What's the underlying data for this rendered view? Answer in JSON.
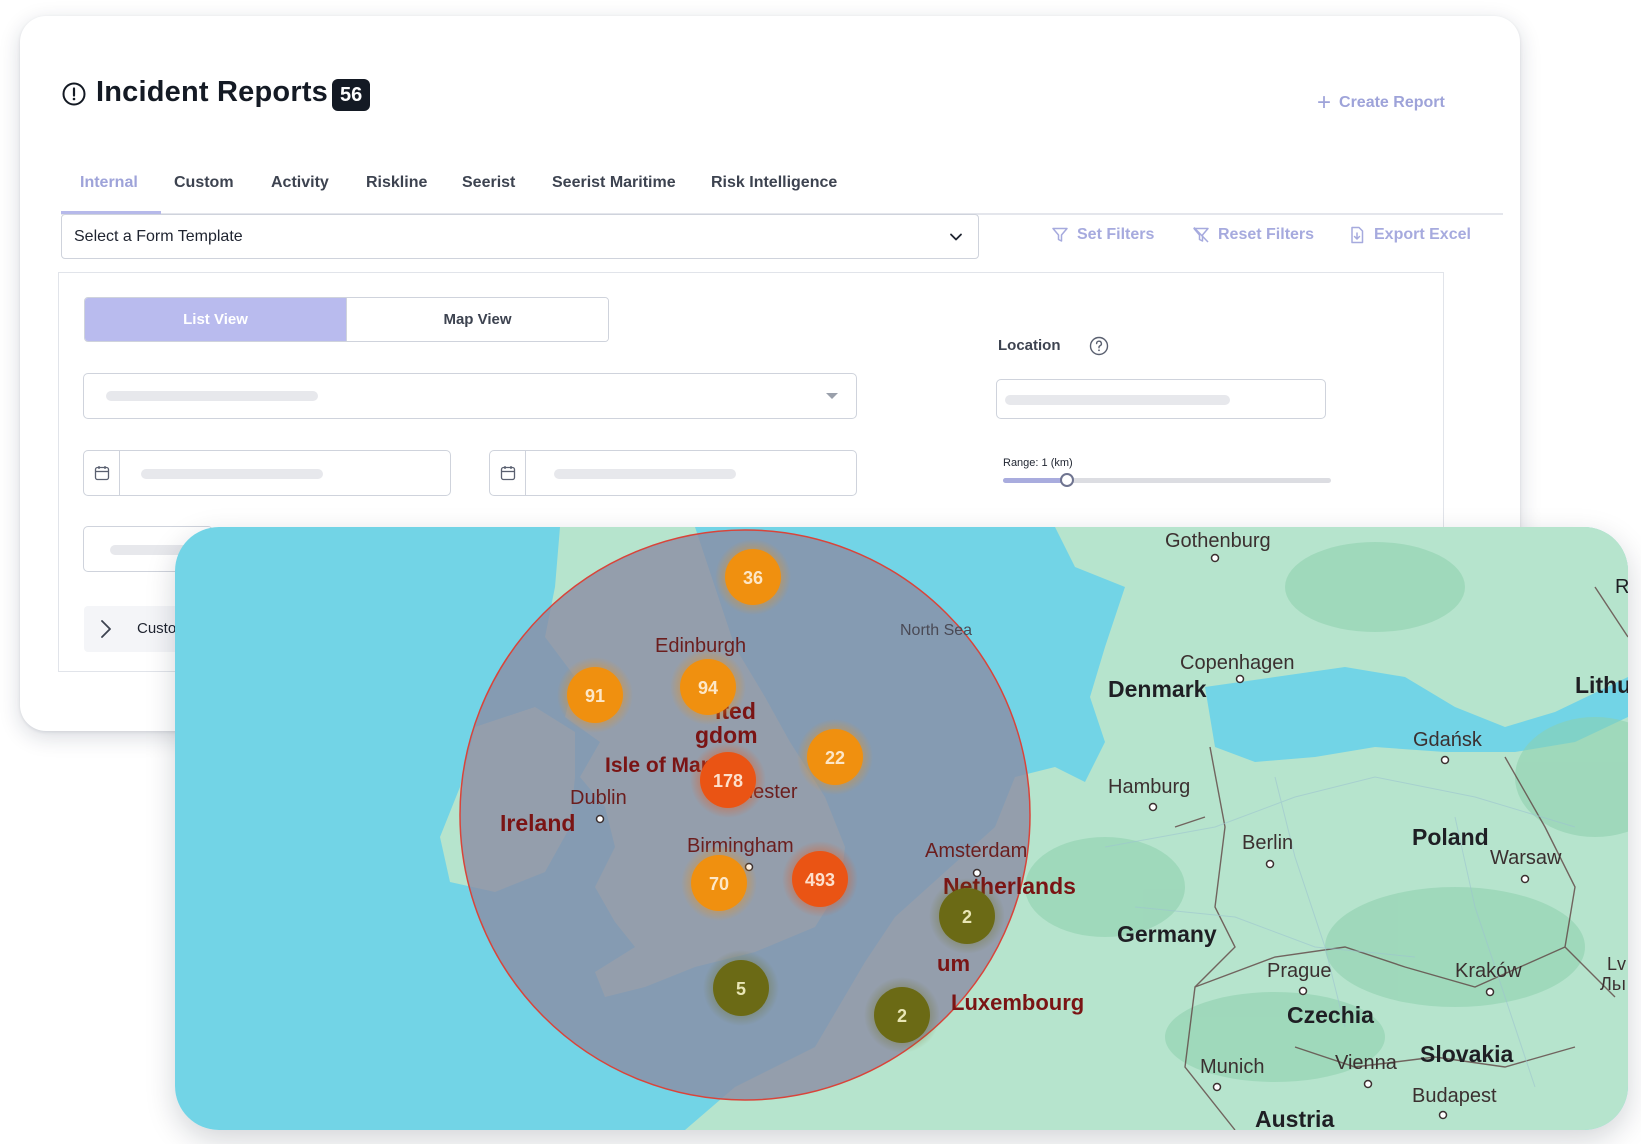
{
  "header": {
    "title": "Incident Reports",
    "count": "56",
    "create_label": "Create Report"
  },
  "tabs": [
    {
      "label": "Internal",
      "active": true
    },
    {
      "label": "Custom"
    },
    {
      "label": "Activity"
    },
    {
      "label": "Riskline"
    },
    {
      "label": "Seerist"
    },
    {
      "label": "Seerist Maritime"
    },
    {
      "label": "Risk Intelligence"
    }
  ],
  "template_select": {
    "value": "Select a Form Template"
  },
  "actions": {
    "set_filters": "Set Filters",
    "reset_filters": "Reset Filters",
    "export_excel": "Export Excel"
  },
  "view_toggle": {
    "list": "List View",
    "map": "Map View",
    "selected": "List View"
  },
  "location": {
    "label": "Location",
    "range_label": "Range: 1 (km)",
    "range_fraction": 0.2
  },
  "custom_row": {
    "label": "Custo"
  },
  "colors": {
    "accent": "#b9bbee",
    "accent_text": "#9ea3d9",
    "sea": "#72d4e6",
    "land": "#b6e4cd",
    "radius_fill": "#8a8aa3",
    "cluster_orange": "#f0900f",
    "cluster_red": "#ea5414",
    "cluster_olive": "#6b6a15"
  },
  "map": {
    "labels": {
      "gothenburg": "Gothenburg",
      "north_sea": "North Sea",
      "edinburgh": "Edinburgh",
      "copenhagen": "Copenhagen",
      "denmark": "Denmark",
      "united_kingdom_1": "ited",
      "united_kingdom_2": "gdom",
      "isle_of_man": "Isle of Man",
      "dublin": "Dublin",
      "ireland": "Ireland",
      "manchester": "hester",
      "birmingham": "Birmingham",
      "london": "n",
      "amsterdam": "Amsterdam",
      "netherlands": "Netherlands",
      "hamburg": "Hamburg",
      "berlin": "Berlin",
      "gdansk": "Gdańsk",
      "poland": "Poland",
      "warsaw": "Warsaw",
      "germany": "Germany",
      "belgium": "um",
      "luxembourg": "Luxembourg",
      "prague": "Prague",
      "czechia": "Czechia",
      "krakow": "Kraków",
      "munich": "Munich",
      "vienna": "Vienna",
      "slovakia": "Slovakia",
      "budapest": "Budapest",
      "austria": "Austria",
      "lithuania": "Lithu",
      "riga": "Ri",
      "lviv_1": "Lv",
      "lviv_2": "Льı"
    },
    "clusters": [
      {
        "id": "c36",
        "count": "36",
        "severity": "orange"
      },
      {
        "id": "c91",
        "count": "91",
        "severity": "orange"
      },
      {
        "id": "c94",
        "count": "94",
        "severity": "orange"
      },
      {
        "id": "c22",
        "count": "22",
        "severity": "orange"
      },
      {
        "id": "c178",
        "count": "178",
        "severity": "red"
      },
      {
        "id": "c70",
        "count": "70",
        "severity": "orange"
      },
      {
        "id": "c493",
        "count": "493",
        "severity": "red"
      },
      {
        "id": "c2a",
        "count": "2",
        "severity": "olive"
      },
      {
        "id": "c5",
        "count": "5",
        "severity": "olive"
      },
      {
        "id": "c2b",
        "count": "2",
        "severity": "olive"
      }
    ]
  }
}
